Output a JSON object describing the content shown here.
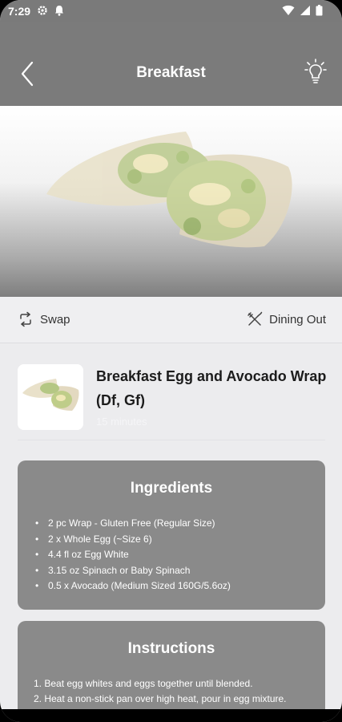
{
  "status": {
    "time": "7:29"
  },
  "header": {
    "title": "Breakfast"
  },
  "actions": {
    "swap_label": "Swap",
    "dining_label": "Dining Out"
  },
  "meal": {
    "name": "Breakfast Egg and Avocado Wrap (Df, Gf)",
    "time": "15 minutes"
  },
  "ingredients": {
    "title": "Ingredients",
    "items": [
      "2 pc Wrap - Gluten Free (Regular Size)",
      "2 x Whole Egg (~Size 6)",
      "4.4 fl oz Egg White",
      "3.15 oz Spinach or Baby Spinach",
      "0.5 x Avocado (Medium Sized 160G/5.6oz)"
    ]
  },
  "instructions": {
    "title": "Instructions",
    "steps": [
      "1. Beat egg whites and eggs together until blended.",
      "2. Heat a non-stick pan over high heat, pour in egg mixture."
    ]
  },
  "colors": {
    "header": "#7b7b7b",
    "card": "#8a8a8a",
    "background": "#ececee"
  }
}
